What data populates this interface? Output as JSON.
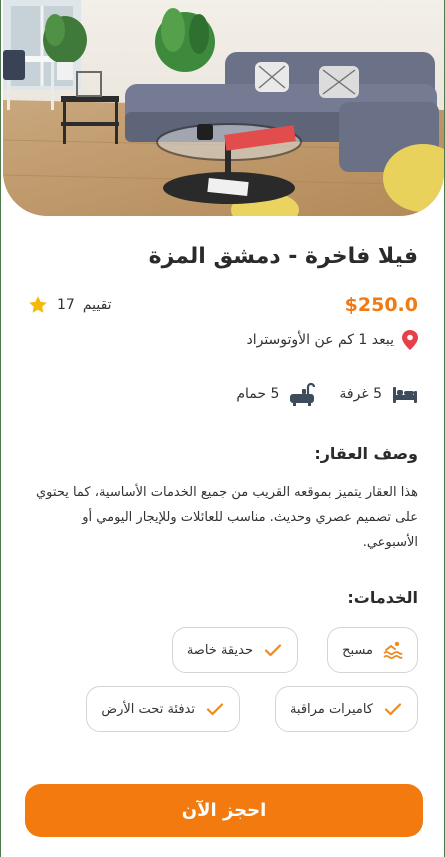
{
  "property": {
    "title": "فيلا فاخرة - دمشق المزة",
    "price": "$250.0",
    "rating_count": "17",
    "rating_label": "تقييم",
    "location": "يبعد 1 كم عن الأوتوستراد",
    "rooms": "5 غرفة",
    "baths": "5 حمام"
  },
  "description": {
    "heading": "وصف العقار:",
    "text": "هذا العقار يتميز بموقعه القريب من جميع الخدمات الأساسية، كما يحتوي على تصميم عصري وحديث. مناسب للعائلات وللإيجار اليومي أو الأسبوعي."
  },
  "services": {
    "heading": "الخدمات:",
    "items": [
      {
        "label": "مسبح",
        "icon": "pool-icon"
      },
      {
        "label": "حديقة خاصة",
        "icon": "check-icon"
      },
      {
        "label": "كاميرات مراقبة",
        "icon": "check-icon"
      },
      {
        "label": "تدفئة تحت الأرض",
        "icon": "check-icon"
      }
    ]
  },
  "actions": {
    "book_label": "احجز الآن"
  },
  "colors": {
    "accent": "#f27a0e",
    "price": "#f07a14",
    "star": "#f5b90a",
    "pin": "#e8404a",
    "icon": "#3d4b5c"
  }
}
